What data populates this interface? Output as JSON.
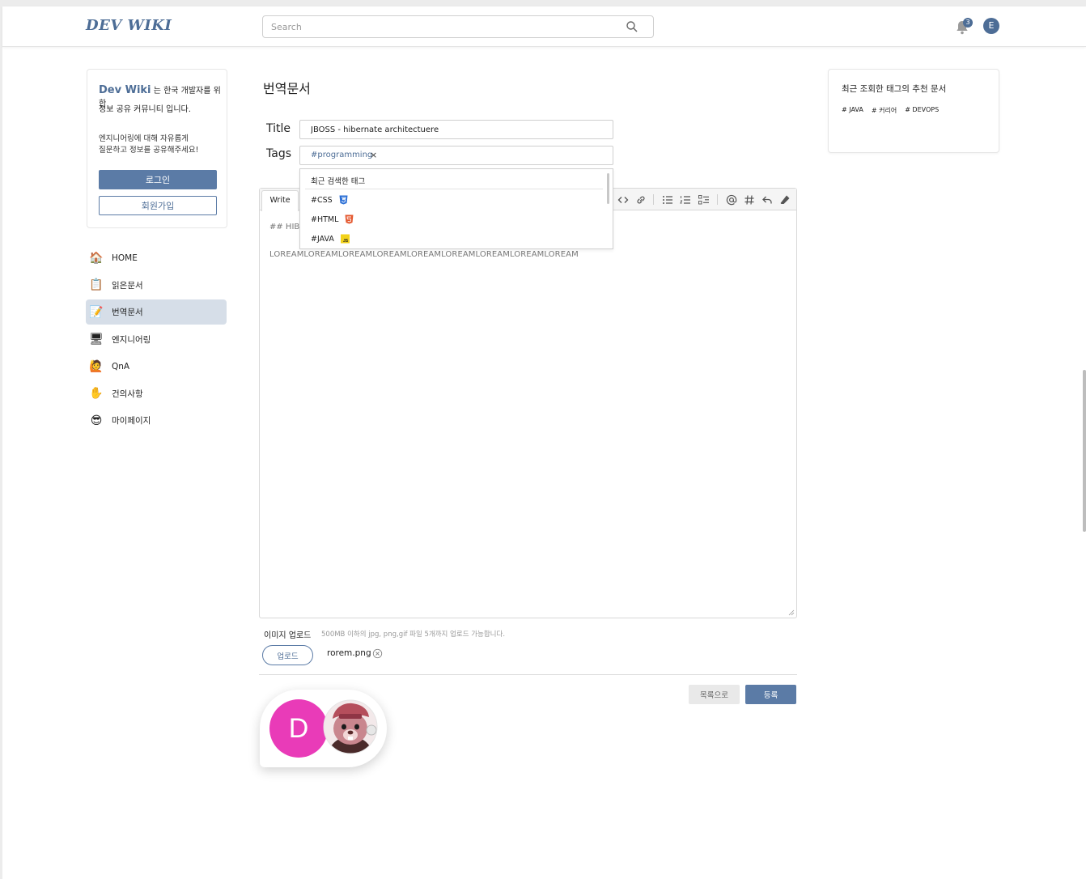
{
  "header": {
    "logo": "DEV WIKI",
    "search_placeholder": "Search",
    "notification_count": "3",
    "user_initial": "E"
  },
  "intro": {
    "brand": "Dev Wiki",
    "line1_rest": " 는 한국 개발자를 위한",
    "line2": "정보 공유 커뮤니티 입니다.",
    "line3": "엔지니어링에 대해 자유롭게",
    "line4": "질문하고 정보를 공유해주세요!",
    "login_label": "로그인",
    "signup_label": "회원가입"
  },
  "nav": {
    "items": [
      {
        "label": "HOME",
        "icon": "house-icon",
        "emoji": "🏠"
      },
      {
        "label": "읽은문서",
        "icon": "document-icon",
        "emoji": "📋"
      },
      {
        "label": "번역문서",
        "icon": "memo-icon",
        "emoji": "📝"
      },
      {
        "label": "엔지니어링",
        "icon": "computer-icon",
        "emoji": "🖥"
      },
      {
        "label": "QnA",
        "icon": "raising-hands-icon",
        "emoji": "🙋"
      },
      {
        "label": "건의사항",
        "icon": "hand-icon",
        "emoji": "✋"
      },
      {
        "label": "마이페이지",
        "icon": "sunglasses-face-icon",
        "emoji": "😎"
      }
    ],
    "active_index": 2
  },
  "form": {
    "page_title": "번역문서",
    "title_label": "Title",
    "title_value": "JBOSS - hibernate architectuere",
    "tags_label": "Tags",
    "tag_chip": "#programming",
    "tag_remove": "×"
  },
  "dropdown": {
    "title": "최근 검색한 태그",
    "items": [
      {
        "label": "#CSS",
        "icon": "css3-icon",
        "color": "#2b6fd6"
      },
      {
        "label": "#HTML",
        "icon": "html5-icon",
        "color": "#e4572e"
      },
      {
        "label": "#JAVA",
        "icon": "javascript-icon",
        "color": "#f2d21a"
      }
    ]
  },
  "editor": {
    "tab_write": "Write",
    "line1": "## HIBE",
    "line2": "LOREAMLOREAMLOREAMLOREAMLOREAMLOREAMLOREAMLOREAMLOREAM"
  },
  "upload": {
    "label": "이미지 업로드",
    "hint": "500MB 이하의 jpg, png,gif 파일 5개까지 업로드 가능합니다.",
    "button_label": "업로드",
    "file_name": "rorem.png"
  },
  "actions": {
    "list_label": "목록으로",
    "submit_label": "등록"
  },
  "float": {
    "avatar_initial": "D",
    "avatar_color": "#e93bb8"
  },
  "recommend": {
    "title": "최근 조회한 태그의 추천 문서",
    "tags": [
      "# JAVA",
      "# 커리어",
      "# DEVOPS"
    ]
  },
  "colors": {
    "accent": "#5b7ba6",
    "brand": "#4d6d96",
    "nav_active": "#d6dee8"
  }
}
